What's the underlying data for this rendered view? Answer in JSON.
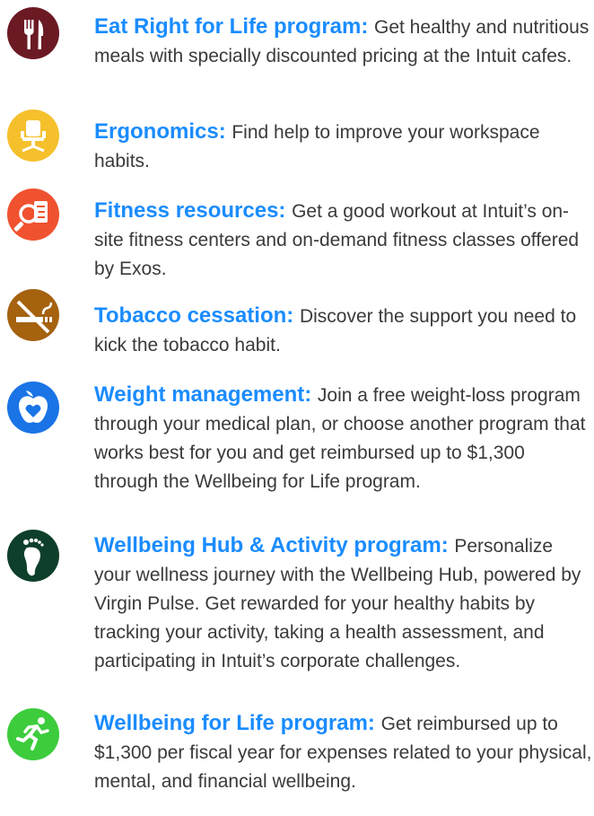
{
  "items": [
    {
      "title": "Eat Right for Life program:",
      "body": "Get healthy and nutritious meals with specially discounted pricing at the Intuit cafes.",
      "icon": "fork-knife-icon",
      "color": "#6b1a24"
    },
    {
      "title": "Ergonomics:",
      "body": "Find help to improve your workspace habits.",
      "icon": "office-chair-icon",
      "color": "#f5c02c"
    },
    {
      "title": "Fitness resources:",
      "body": "Get a good workout at Intuit’s on-site fitness centers and on-demand fitness classes offered by Exos.",
      "icon": "magnifier-checklist-icon",
      "color": "#f0522f"
    },
    {
      "title": "Tobacco cessation:",
      "body": "Discover the support you need to kick the tobacco habit.",
      "icon": "no-smoking-icon",
      "color": "#a5620f"
    },
    {
      "title": "Weight management:",
      "body": "Join a free weight-loss program through your medical plan, or choose another program that works best for you and get reimbursed up to $1,300 through the Wellbeing for Life program.",
      "icon": "apple-heart-icon",
      "color": "#1a74e6"
    },
    {
      "title": "Wellbeing Hub & Activity program:",
      "body": "Personalize your wellness journey with the Wellbeing Hub, powered by Virgin Pulse. Get rewarded for your healthy habits by tracking your activity, taking a health assessment, and participating in Intuit’s corporate challenges.",
      "icon": "footprint-icon",
      "color": "#0e3f2a"
    },
    {
      "title": "Wellbeing for Life program:",
      "body": "Get reimbursed up to $1,300 per fiscal year for expenses related to your physical, mental, and financial wellbeing.",
      "icon": "running-person-icon",
      "color": "#3ccc3c"
    }
  ]
}
